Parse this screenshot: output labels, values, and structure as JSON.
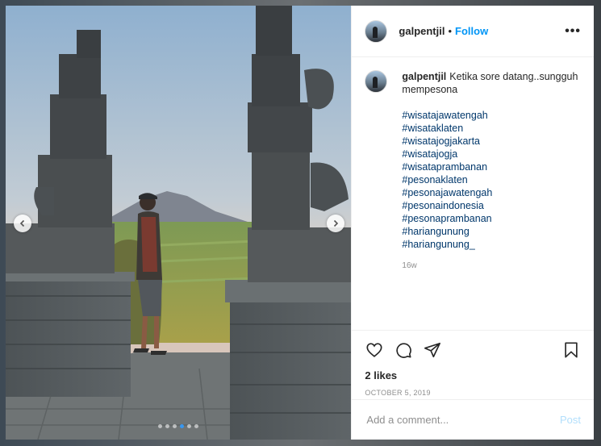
{
  "post": {
    "username": "galpentjil",
    "header_separator": "•",
    "follow_label": "Follow",
    "more_label": "•••",
    "caption_text": "Ketika sore datang..sungguh mempesona",
    "hashtags": [
      "#wisatajawatengah",
      "#wisataklaten",
      "#wisatajogjakarta",
      "#wisatajogja",
      "#wisataprambanan",
      "#pesonaklaten",
      "#pesonajawatengah",
      "#pesonaindonesia",
      "#pesonaprambanan",
      "#hariangunung",
      "#hariangunung_"
    ],
    "caption_age": "16w",
    "likes": "2 likes",
    "date": "OCTOBER 5, 2019",
    "comment_placeholder": "Add a comment...",
    "post_label": "Post"
  },
  "carousel": {
    "slide_count": 6,
    "active_index": 3,
    "prev_icon": "chevron-left-icon",
    "next_icon": "chevron-right-icon"
  },
  "colors": {
    "link_blue": "#0095f6",
    "hashtag": "#00376b",
    "post_disabled": "#b2dffc",
    "active_dot": "#3897f0"
  }
}
